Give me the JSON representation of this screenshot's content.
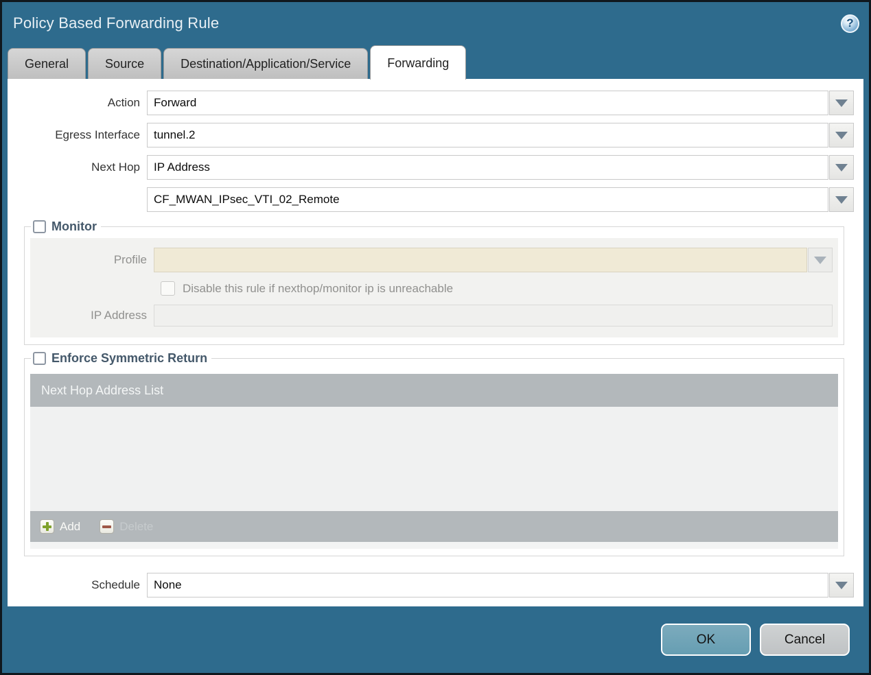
{
  "dialog": {
    "title": "Policy Based Forwarding Rule",
    "help_glyph": "?"
  },
  "tabs": [
    {
      "label": "General",
      "active": false
    },
    {
      "label": "Source",
      "active": false
    },
    {
      "label": "Destination/Application/Service",
      "active": false
    },
    {
      "label": "Forwarding",
      "active": true
    }
  ],
  "form": {
    "action": {
      "label": "Action",
      "value": "Forward"
    },
    "egress_interface": {
      "label": "Egress Interface",
      "value": "tunnel.2"
    },
    "next_hop": {
      "label": "Next Hop",
      "value": "IP Address"
    },
    "next_hop_address": {
      "value": "CF_MWAN_IPsec_VTI_02_Remote"
    },
    "schedule": {
      "label": "Schedule",
      "value": "None"
    }
  },
  "monitor": {
    "label": "Monitor",
    "checked": false,
    "profile": {
      "label": "Profile",
      "value": ""
    },
    "disable_rule": {
      "label": "Disable this rule if nexthop/monitor ip is unreachable",
      "checked": false
    },
    "ip_address": {
      "label": "IP Address",
      "value": ""
    }
  },
  "symmetric_return": {
    "label": "Enforce Symmetric Return",
    "checked": false,
    "table": {
      "header": "Next Hop Address List",
      "rows": []
    },
    "add_label": "Add",
    "delete_label": "Delete"
  },
  "footer": {
    "ok_label": "OK",
    "cancel_label": "Cancel"
  },
  "colors": {
    "titlebar_teal": "#2e6b8d",
    "dark_border": "#10171d",
    "ok_button": "#6ea4b8",
    "cancel_button": "#c6c9cb",
    "table_header_gray": "#b3b8bb",
    "disabled_beige_field": "#f0ead6",
    "group_title_text": "#44586a",
    "arrow_blue_gray": "#6f8191"
  }
}
